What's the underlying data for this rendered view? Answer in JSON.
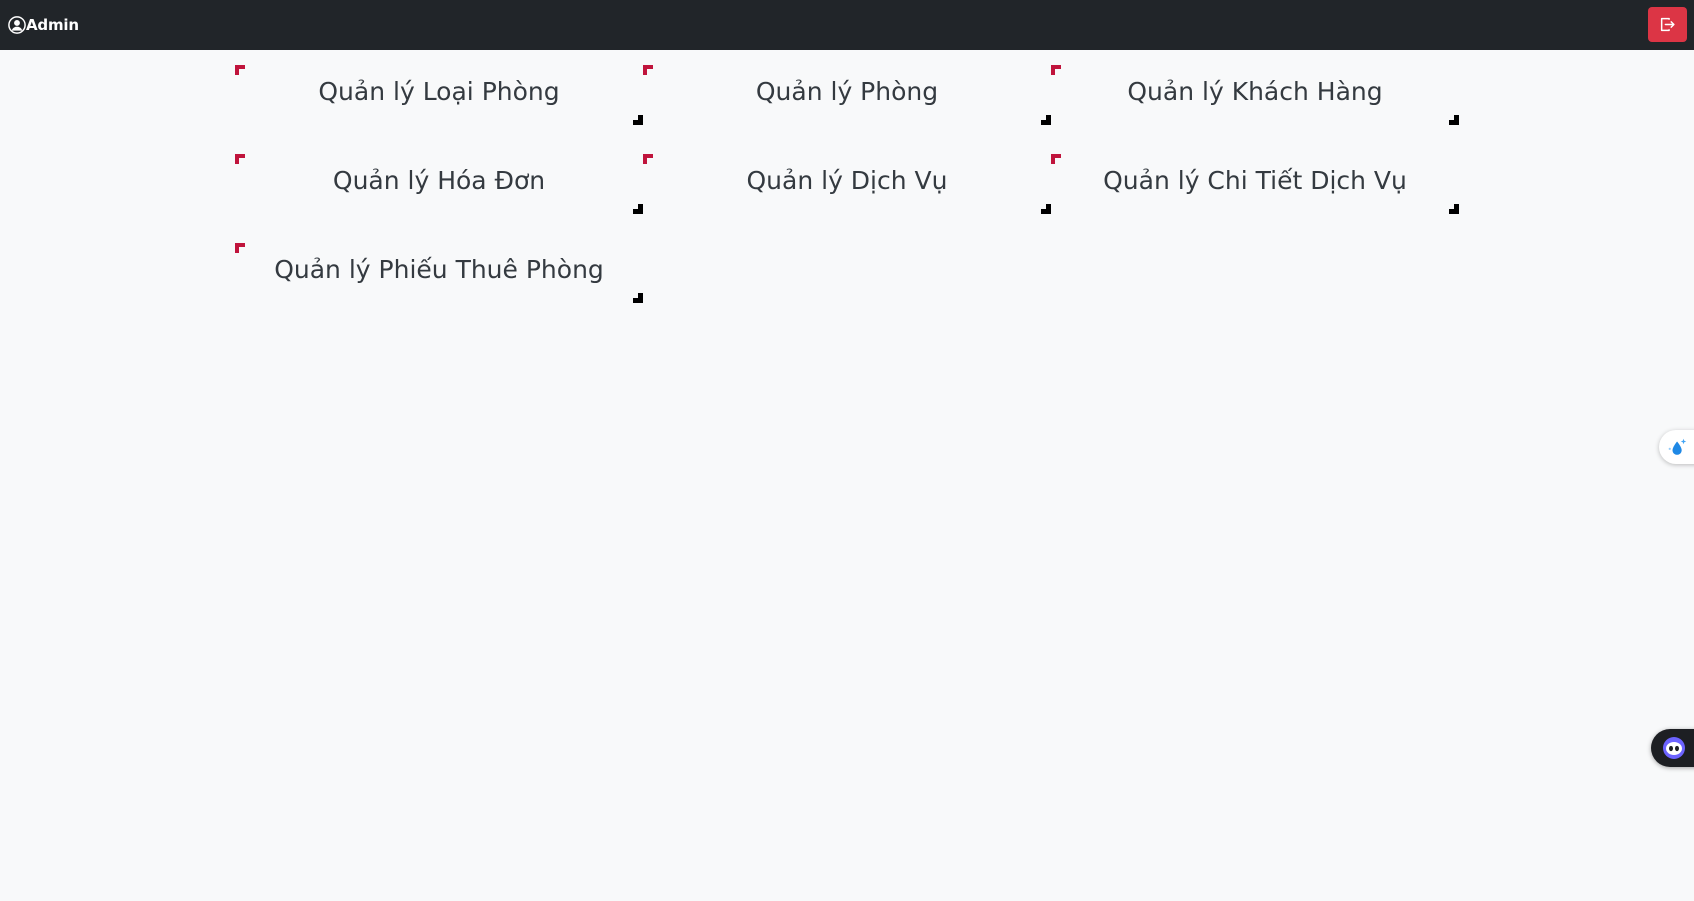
{
  "header": {
    "user_label": "Admin",
    "user_icon": "user-circle-icon",
    "logout_icon": "logout-icon",
    "logout_color": "#dc3545",
    "background": "#212529"
  },
  "menu": {
    "items": [
      {
        "label": "Quản lý Loại Phòng"
      },
      {
        "label": "Quản lý Phòng"
      },
      {
        "label": "Quản lý Khách Hàng"
      },
      {
        "label": "Quản lý Hóa Đơn"
      },
      {
        "label": "Quản lý Dịch Vụ"
      },
      {
        "label": "Quản lý Chi Tiết Dịch Vụ"
      },
      {
        "label": "Quản lý Phiếu Thuê Phòng"
      }
    ],
    "corner_colors": {
      "top_left": "#c0143c",
      "bottom_right": "#000000"
    }
  },
  "widgets": {
    "side_icon": "sparkle-drop-icon",
    "chat_icon": "chat-bot-icon"
  }
}
